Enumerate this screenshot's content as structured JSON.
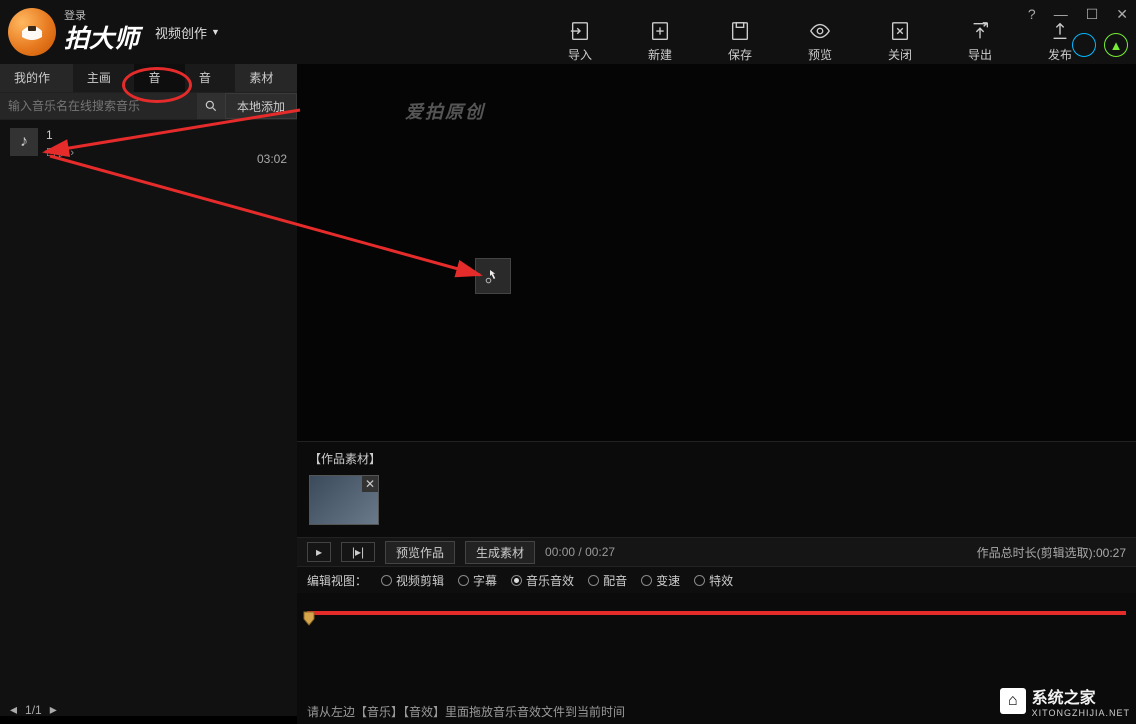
{
  "header": {
    "login": "登录",
    "brand": "拍大师",
    "mode": "视频创作",
    "toolbar": [
      {
        "icon": "import",
        "label": "导入"
      },
      {
        "icon": "new",
        "label": "新建"
      },
      {
        "icon": "save",
        "label": "保存"
      },
      {
        "icon": "preview",
        "label": "预览"
      },
      {
        "icon": "close",
        "label": "关闭"
      },
      {
        "icon": "export",
        "label": "导出"
      },
      {
        "icon": "publish",
        "label": "发布"
      }
    ]
  },
  "tabs": [
    "我的作品",
    "主画面",
    "音乐",
    "音效",
    "素材库"
  ],
  "search": {
    "placeholder": "输入音乐名在线搜索音乐",
    "local_add": "本地添加"
  },
  "music_items": [
    {
      "title": "1",
      "duration": "03:02"
    }
  ],
  "pager": {
    "text": "1/1"
  },
  "preview": {
    "watermark": "爱拍原创",
    "assets_label": "【作品素材】"
  },
  "playbar": {
    "preview_btn": "预览作品",
    "generate_btn": "生成素材",
    "time": "00:00 / 00:27",
    "total": "作品总时长(剪辑选取):00:27"
  },
  "editview": {
    "label": "编辑视图：",
    "options": [
      "视频剪辑",
      "字幕",
      "音乐音效",
      "配音",
      "变速",
      "特效"
    ],
    "selected": "音乐音效"
  },
  "hint": "请从左边【音乐】【音效】里面拖放音乐音效文件到当前时间",
  "watermark": {
    "brand": "系统之家",
    "url": "XITONGZHIJIA.NET"
  }
}
